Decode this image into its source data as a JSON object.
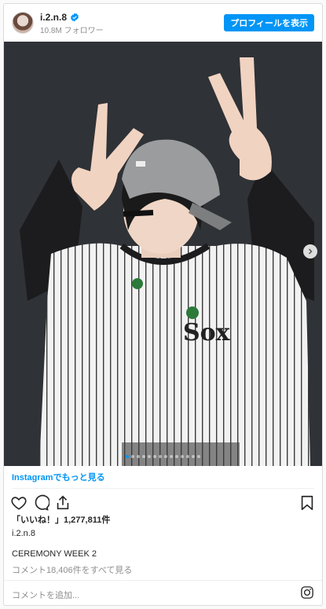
{
  "header": {
    "username": "i.2.n.8",
    "followers": "10.8M フォロワー",
    "follow_button": "プロフィールを表示"
  },
  "carousel": {
    "slides": 14,
    "active_index": 0
  },
  "links": {
    "more_on_instagram": "Instagramでもっと見る"
  },
  "engagement": {
    "likes": "「いいね！」1,277,811件"
  },
  "caption": {
    "username": "i.2.n.8",
    "text": "CEREMONY WEEK 2",
    "view_comments": "コメント18,406件をすべて見る"
  },
  "comment_box": {
    "placeholder": "コメントを追加..."
  },
  "icons": {
    "heart": "heart-icon",
    "comment": "comment-icon",
    "share": "share-icon",
    "save": "bookmark-icon",
    "verified": "verified-badge-icon",
    "instagram": "instagram-icon"
  },
  "colors": {
    "accent": "#0095f6",
    "muted": "#8e8e8e",
    "text": "#262626"
  }
}
